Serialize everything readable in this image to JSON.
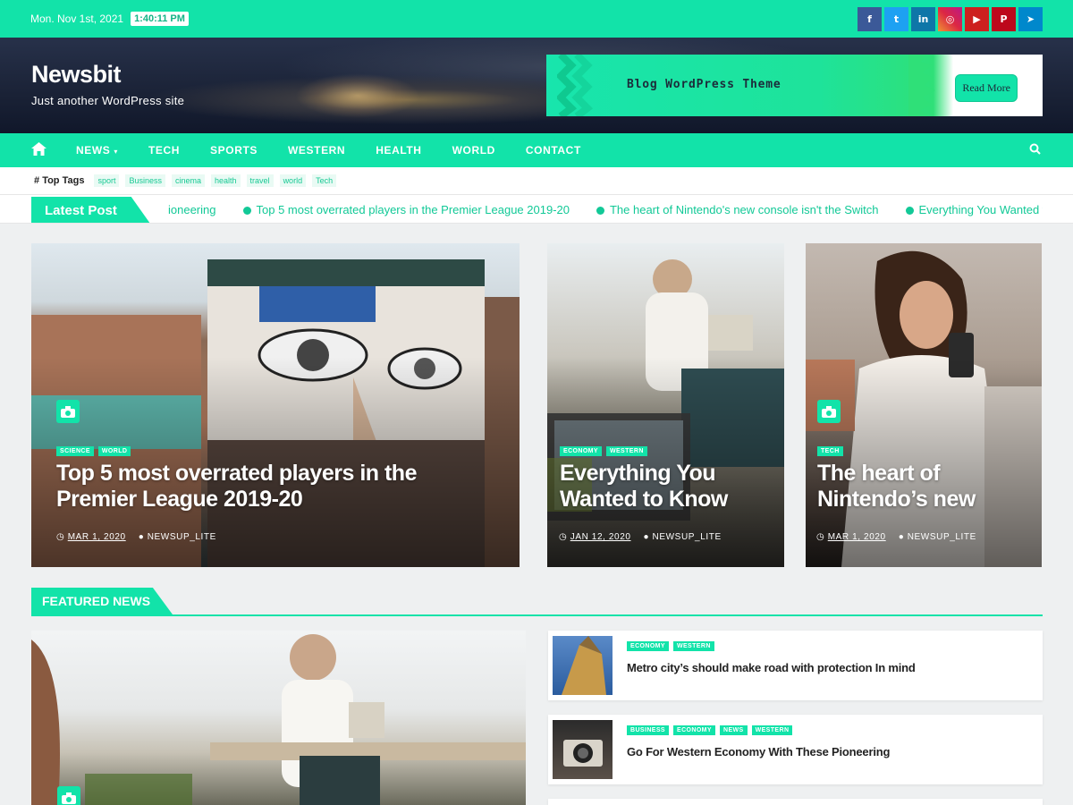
{
  "topbar": {
    "date": "Mon. Nov 1st, 2021",
    "time": "1:40:11 PM",
    "socials": [
      {
        "icon": "facebook-icon",
        "glyph": "f",
        "color": "#3b5998"
      },
      {
        "icon": "twitter-icon",
        "glyph": "t",
        "color": "#1da1f2"
      },
      {
        "icon": "linkedin-icon",
        "glyph": "in",
        "color": "#0e76a8"
      },
      {
        "icon": "instagram-icon",
        "glyph": "◎",
        "color": "#c13584"
      },
      {
        "icon": "youtube-icon",
        "glyph": "▶",
        "color": "#cd201f"
      },
      {
        "icon": "pinterest-icon",
        "glyph": "P",
        "color": "#bd081c"
      },
      {
        "icon": "telegram-icon",
        "glyph": "➤",
        "color": "#0088cc"
      }
    ]
  },
  "header": {
    "site_title": "Newsbit",
    "tagline": "Just another WordPress site",
    "ad_text": "Blog WordPress Theme",
    "ad_button": "Read More"
  },
  "nav": {
    "items": [
      "NEWS",
      "TECH",
      "SPORTS",
      "WESTERN",
      "HEALTH",
      "WORLD",
      "CONTACT"
    ]
  },
  "tags": {
    "label": "Top Tags",
    "items": [
      "sport",
      "Business",
      "cinema",
      "health",
      "travel",
      "world",
      "Tech"
    ]
  },
  "ticker": {
    "label": "Latest Post",
    "items": [
      "ioneering",
      "Top 5 most overrated players in the Premier League 2019-20",
      "The heart of Nintendo's new console isn't the Switch",
      "Everything You Wanted to Know Abou"
    ]
  },
  "hero": [
    {
      "cats": [
        "SCIENCE",
        "WORLD"
      ],
      "title_1": "Top 5 most overrated players in the",
      "title_2": "Premier League 2019-20",
      "date": "MAR 1, 2020",
      "author": "NEWSUP_LITE"
    },
    {
      "cats": [
        "ECONOMY",
        "WESTERN"
      ],
      "title_1": "Everything You",
      "title_2": "Wanted to Know",
      "date": "JAN 12, 2020",
      "author": "NEWSUP_LITE"
    },
    {
      "cats": [
        "TECH"
      ],
      "title_1": "The heart of",
      "title_2": "Nintendo’s new",
      "date": "MAR 1, 2020",
      "author": "NEWSUP_LITE"
    }
  ],
  "featured": {
    "label": "FEATURED NEWS",
    "list": [
      {
        "cats": [
          "ECONOMY",
          "WESTERN"
        ],
        "title": "Metro city’s should make road with protection In mind"
      },
      {
        "cats": [
          "BUSINESS",
          "ECONOMY",
          "NEWS",
          "WESTERN"
        ],
        "title": "Go For Western Economy With These Pioneering"
      }
    ]
  },
  "colors": {
    "accent": "#12e3a9",
    "accent_text": "#12c997"
  }
}
